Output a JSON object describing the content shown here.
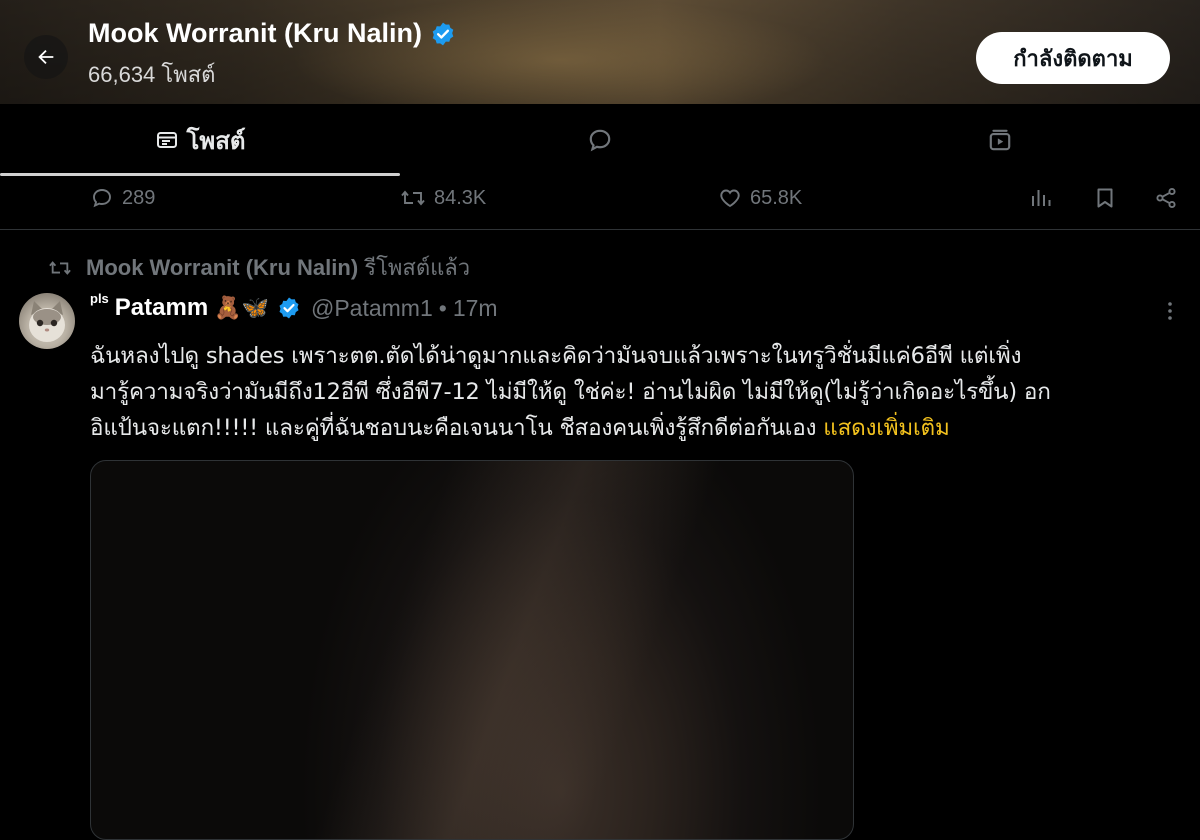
{
  "header": {
    "title": "Mook Worranit (Kru Nalin)",
    "post_count": "66,634 โพสต์",
    "follow_label": "กำลังติดตาม"
  },
  "tabs": [
    {
      "label": "โพสต์",
      "icon": "posts-icon",
      "active": true
    },
    {
      "label": "",
      "icon": "replies-icon",
      "active": false
    },
    {
      "label": "",
      "icon": "media-icon",
      "active": false
    }
  ],
  "actions": {
    "replies": "289",
    "reposts": "84.3K",
    "likes": "65.8K"
  },
  "repost": {
    "user": "Mook Worranit (Kru Nalin)",
    "suffix": "รีโพสต์แล้ว"
  },
  "tweet": {
    "prefix": "pls",
    "display_name": "Patamm",
    "emojis": "🧸🦋",
    "handle": "@Patamm1",
    "separator": "•",
    "time": "17m",
    "lines": [
      "ฉันหลงไปดู shades เพราะตต.ตัดได้น่าดูมากและคิดว่ามันจบแล้วเพราะในทรูวิชั่นมีแค่6อีพี  แต่เพิ่ง",
      "มารู้ความจริงว่ามันมีถึง12อีพี ซึ่งอีพี7-12 ไม่มีให้ดู ใช่ค่ะ! อ่านไม่ผิด ไม่มีให้ดู(ไม่รู้ว่าเกิดอะไรขึ้น) อก",
      "อิแป้นจะแตก!!!!! และคู่ที่ฉันชอบนะคือเจนนาโน ชีสองคนเพิ่งรู้สึกดีต่อกันเอง "
    ],
    "show_more": "แสดงเพิ่มเติม"
  },
  "colors": {
    "accent_verified": "#1d9bf0",
    "show_more": "#f3c21e",
    "muted": "#71767b"
  }
}
